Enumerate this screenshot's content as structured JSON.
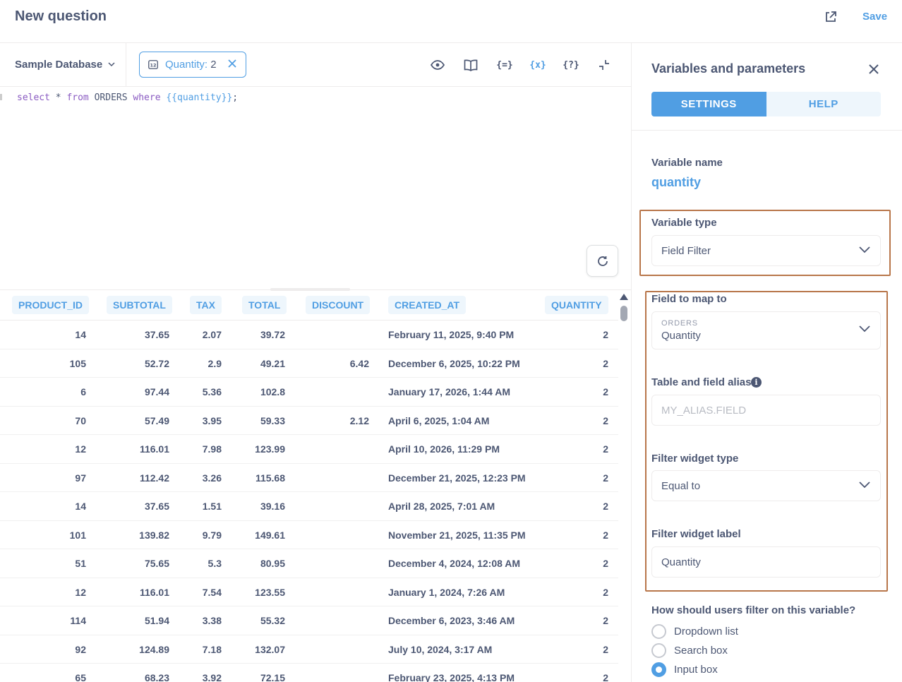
{
  "header": {
    "title": "New question",
    "save_label": "Save"
  },
  "editor": {
    "database": "Sample Database",
    "variable_pill": {
      "label": "Quantity:",
      "value": "2"
    },
    "tools": {
      "variables": "{=}",
      "snippets": "{x}",
      "params": "{?}"
    },
    "sql": {
      "kw1": "select",
      "t1": " * ",
      "kw2": "from",
      "t2": " ORDERS ",
      "kw3": "where",
      "t3": " ",
      "var": "{{quantity}}",
      "t4": ";"
    }
  },
  "table": {
    "columns": [
      "PRODUCT_ID",
      "SUBTOTAL",
      "TAX",
      "TOTAL",
      "DISCOUNT",
      "CREATED_AT",
      "QUANTITY"
    ],
    "rows": [
      [
        "14",
        "37.65",
        "2.07",
        "39.72",
        "",
        "February 11, 2025, 9:40 PM",
        "2"
      ],
      [
        "105",
        "52.72",
        "2.9",
        "49.21",
        "6.42",
        "December 6, 2025, 10:22 PM",
        "2"
      ],
      [
        "6",
        "97.44",
        "5.36",
        "102.8",
        "",
        "January 17, 2026, 1:44 AM",
        "2"
      ],
      [
        "70",
        "57.49",
        "3.95",
        "59.33",
        "2.12",
        "April 6, 2025, 1:04 AM",
        "2"
      ],
      [
        "12",
        "116.01",
        "7.98",
        "123.99",
        "",
        "April 10, 2026, 11:29 PM",
        "2"
      ],
      [
        "97",
        "112.42",
        "3.26",
        "115.68",
        "",
        "December 21, 2025, 12:23 PM",
        "2"
      ],
      [
        "14",
        "37.65",
        "1.51",
        "39.16",
        "",
        "April 28, 2025, 7:01 AM",
        "2"
      ],
      [
        "101",
        "139.82",
        "9.79",
        "149.61",
        "",
        "November 21, 2025, 11:35 PM",
        "2"
      ],
      [
        "51",
        "75.65",
        "5.3",
        "80.95",
        "",
        "December 4, 2024, 12:08 AM",
        "2"
      ],
      [
        "12",
        "116.01",
        "7.54",
        "123.55",
        "",
        "January 1, 2024, 7:26 AM",
        "2"
      ],
      [
        "114",
        "51.94",
        "3.38",
        "55.32",
        "",
        "December 6, 2023, 3:46 AM",
        "2"
      ],
      [
        "92",
        "124.89",
        "7.18",
        "132.07",
        "",
        "July 10, 2024, 3:17 AM",
        "2"
      ],
      [
        "65",
        "68.23",
        "3.92",
        "72.15",
        "",
        "February 23, 2025, 4:13 PM",
        "2"
      ]
    ]
  },
  "panel": {
    "title": "Variables and parameters",
    "tabs": {
      "settings": "SETTINGS",
      "help": "HELP"
    },
    "variable_name_label": "Variable name",
    "variable_name": "quantity",
    "variable_type_label": "Variable type",
    "variable_type": "Field Filter",
    "field_map_label": "Field to map to",
    "field_table": "ORDERS",
    "field_name": "Quantity",
    "alias_label": "Table and field alias",
    "alias_placeholder": "MY_ALIAS.FIELD",
    "widget_type_label": "Filter widget type",
    "widget_type": "Equal to",
    "widget_label_label": "Filter widget label",
    "widget_label": "Quantity",
    "filter_question": "How should users filter on this variable?",
    "filter_options": [
      "Dropdown list",
      "Search box",
      "Input box"
    ],
    "filter_selected": "Input box"
  },
  "colors": {
    "brand": "#509ee3",
    "text": "#4c5773",
    "highlight": "#b8764a"
  }
}
